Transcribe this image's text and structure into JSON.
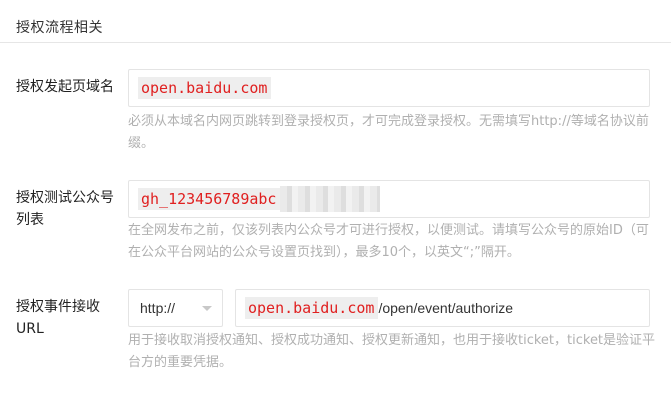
{
  "section": {
    "title": "授权流程相关"
  },
  "domain_row": {
    "label": "授权发起页域名",
    "value": "open.baidu.com",
    "hint": "必须从本域名内网页跳转到登录授权页，才可完成登录授权。无需填写http://等域名协议前缀。"
  },
  "test_accounts_row": {
    "label": "授权测试公众号列表",
    "value_visible": "gh_123456789abc",
    "hint": "在全网发布之前，仅该列表内公众号才可进行授权，以便测试。请填写公众号的原始ID（可在公众平台网站的公众号设置页找到），最多10个，以英文“;”隔开。"
  },
  "event_url_row": {
    "label": "授权事件接收URL",
    "protocol": "http://",
    "url_domain": "open.baidu.com",
    "url_path": "/open/event/authorize",
    "hint": "用于接收取消授权通知、授权成功通知、授权更新通知，也用于接收ticket，ticket是验证平台方的重要凭据。"
  },
  "colors": {
    "highlight_text": "#e02020",
    "highlight_bg": "#eeeeee",
    "hint_text": "#b0b0b0",
    "border": "#e4e4e4"
  },
  "icons": {
    "protocol_dropdown": "chevron-down-icon"
  }
}
